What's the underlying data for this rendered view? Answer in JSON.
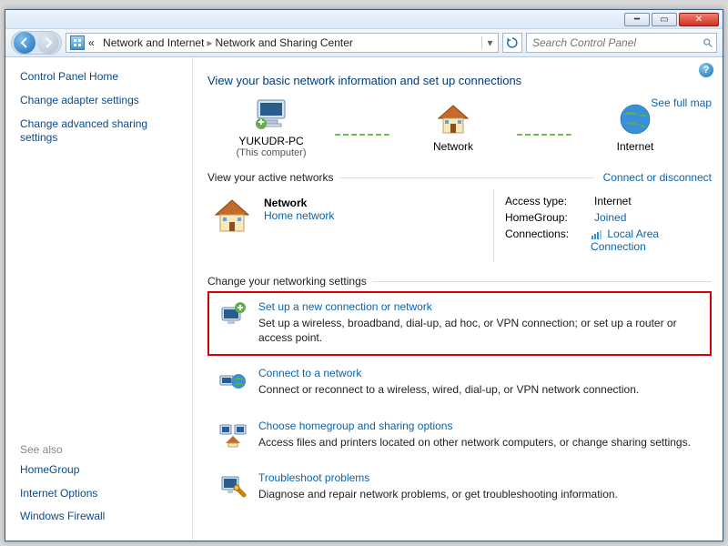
{
  "titlebar": {
    "min_symbol": "━",
    "max_symbol": "▭",
    "close_symbol": "✕"
  },
  "addrbar": {
    "chev": "«",
    "crumb1": "Network and Internet",
    "crumb2": "Network and Sharing Center",
    "search_placeholder": "Search Control Panel"
  },
  "sidebar": {
    "home": "Control Panel Home",
    "links": [
      "Change adapter settings",
      "Change advanced sharing settings"
    ],
    "see_also_hdr": "See also",
    "see_also": [
      "HomeGroup",
      "Internet Options",
      "Windows Firewall"
    ]
  },
  "content": {
    "title": "View your basic network information and set up connections",
    "map": {
      "col1_name": "YUKUDR-PC",
      "col1_sub": "(This computer)",
      "col2_name": "Network",
      "col3_name": "Internet",
      "full_map": "See full map"
    },
    "active_hdr": "View your active networks",
    "active_link": "Connect or disconnect",
    "active": {
      "name": "Network",
      "type": "Home network",
      "kv": {
        "access_k": "Access type:",
        "access_v": "Internet",
        "home_k": "HomeGroup:",
        "home_v": "Joined",
        "conn_k": "Connections:",
        "conn_v": "Local Area Connection"
      }
    },
    "change_hdr": "Change your networking settings",
    "settings": [
      {
        "title": "Set up a new connection or network",
        "desc": "Set up a wireless, broadband, dial-up, ad hoc, or VPN connection; or set up a router or access point."
      },
      {
        "title": "Connect to a network",
        "desc": "Connect or reconnect to a wireless, wired, dial-up, or VPN network connection."
      },
      {
        "title": "Choose homegroup and sharing options",
        "desc": "Access files and printers located on other network computers, or change sharing settings."
      },
      {
        "title": "Troubleshoot problems",
        "desc": "Diagnose and repair network problems, or get troubleshooting information."
      }
    ]
  }
}
